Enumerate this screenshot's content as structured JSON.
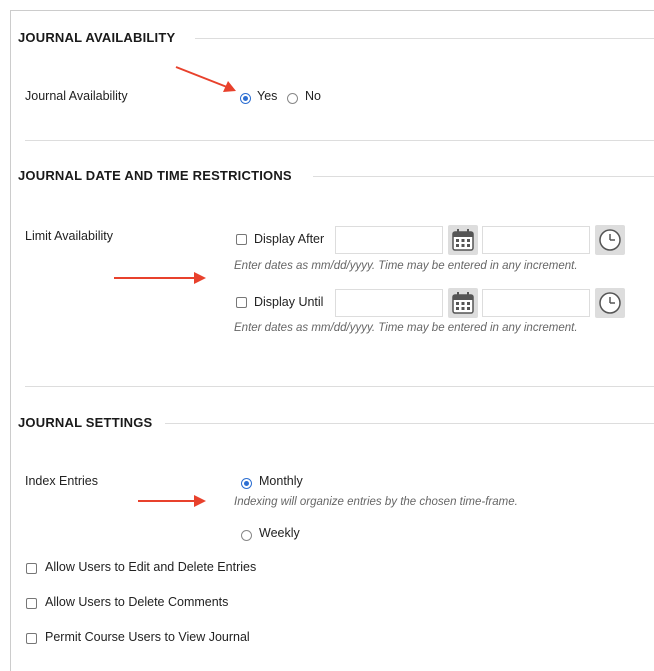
{
  "journal_availability": {
    "title": "JOURNAL AVAILABILITY",
    "label": "Journal Availability",
    "options": [
      {
        "label": "Yes",
        "checked": true
      },
      {
        "label": "No",
        "checked": false
      }
    ]
  },
  "date_restrictions": {
    "title": "JOURNAL DATE AND TIME RESTRICTIONS",
    "label": "Limit Availability",
    "display_after": {
      "label": "Display After",
      "date_value": "",
      "time_value": "",
      "checked": false
    },
    "display_until": {
      "label": "Display Until",
      "date_value": "",
      "time_value": "",
      "checked": false
    },
    "hint": "Enter dates as mm/dd/yyyy. Time may be entered in any increment."
  },
  "settings": {
    "title": "JOURNAL SETTINGS",
    "index_label": "Index Entries",
    "monthly": {
      "label": "Monthly",
      "checked": true
    },
    "monthly_hint": "Indexing will organize entries by the chosen time-frame.",
    "weekly": {
      "label": "Weekly",
      "checked": false
    },
    "checkboxes": [
      {
        "label": "Allow Users to Edit and Delete Entries",
        "checked": false
      },
      {
        "label": "Allow Users to Delete Comments",
        "checked": false
      },
      {
        "label": "Permit Course Users to View Journal",
        "checked": false
      }
    ]
  },
  "colors": {
    "accent": "#2d6fd2",
    "arrow": "#e8412c",
    "rule": "#dddddd"
  },
  "icons": [
    "calendar-icon",
    "clock-icon",
    "annotation-arrow"
  ]
}
